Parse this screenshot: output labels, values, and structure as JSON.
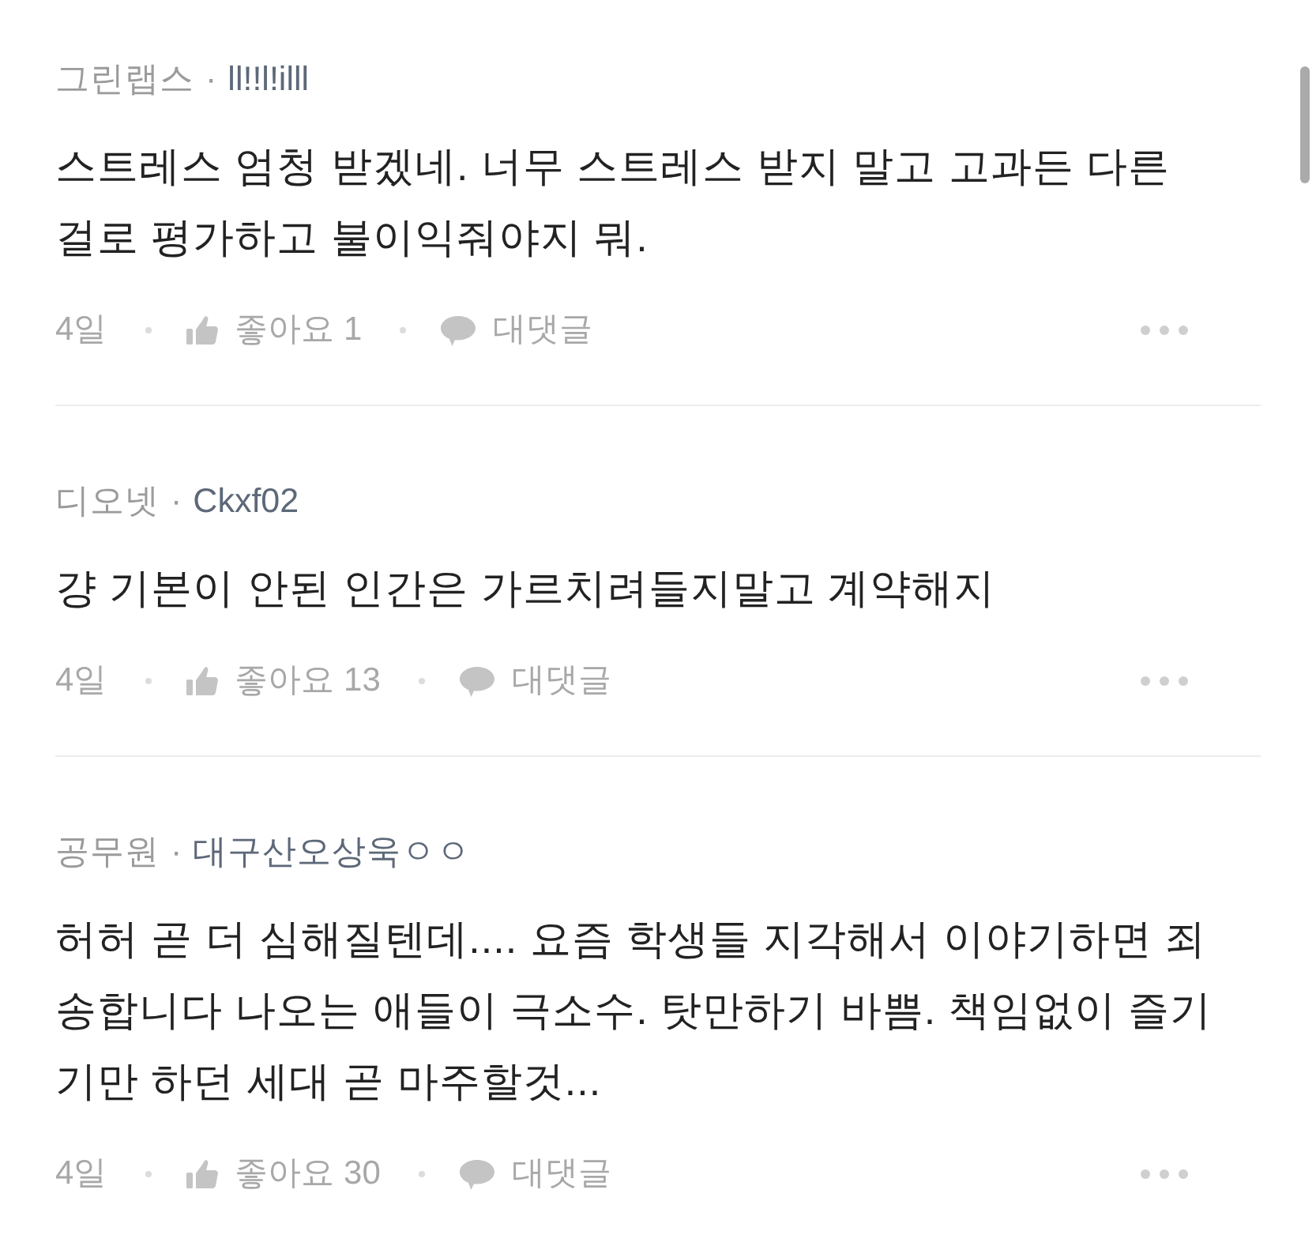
{
  "comments": [
    {
      "author": "그린랩스",
      "separator": "·",
      "nickname": "ll!!l!illl",
      "body": "스트레스 엄청 받겠네. 너무 스트레스 받지 말고 고과든 다른 걸로 평가하고 불이익줘야지 뭐.",
      "time": "4일",
      "likes": "좋아요 1",
      "reply": "대댓글"
    },
    {
      "author": "디오넷",
      "separator": "·",
      "nickname": "Ckxf02",
      "body": "걍 기본이 안된 인간은 가르치려들지말고 계약해지",
      "time": "4일",
      "likes": "좋아요 13",
      "reply": "대댓글"
    },
    {
      "author": "공무원",
      "separator": "·",
      "nickname": "대구산오상욱ㅇㅇ",
      "body": "허허 곧 더 심해질텐데.... 요즘 학생들 지각해서 이야기하면 죄송합니다 나오는 애들이 극소수. 탓만하기 바쁨. 책임없이 즐기기만 하던 세대 곧 마주할것...",
      "time": "4일",
      "likes": "좋아요 30",
      "reply": "대댓글"
    }
  ]
}
